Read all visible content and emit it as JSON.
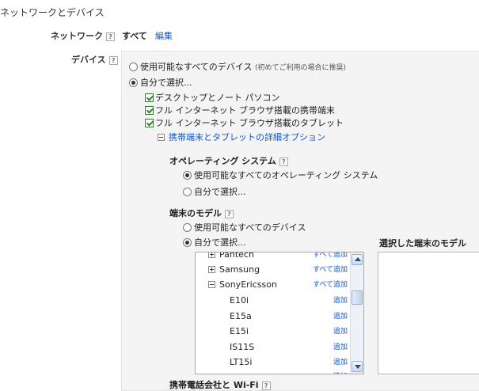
{
  "page": {
    "title": "ネットワークとデバイス"
  },
  "network": {
    "label": "ネットワーク",
    "help": "?",
    "value": "すべて",
    "edit_link": "編集"
  },
  "devices": {
    "label": "デバイス",
    "help": "?",
    "all_devices": {
      "label": "使用可能なすべてのデバイス",
      "hint": "(初めてご利用の場合に推奨)",
      "selected": false
    },
    "custom": {
      "label": "自分で選択...",
      "selected": true
    },
    "checkboxes": [
      {
        "label": "デスクトップとノート パソコン",
        "checked": true
      },
      {
        "label": "フル インターネット ブラウザ搭載の携帯端末",
        "checked": true
      },
      {
        "label": "フル インターネット ブラウザ搭載のタブレット",
        "checked": true
      }
    ],
    "advanced_link": "携帯端末とタブレットの詳細オプション"
  },
  "os": {
    "title": "オペレーティング システム",
    "help": "?",
    "all": {
      "label": "使用可能なすべてのオペレーティング システム",
      "selected": true
    },
    "custom": {
      "label": "自分で選択...",
      "selected": false
    }
  },
  "model": {
    "title": "端末のモデル",
    "help": "?",
    "all": {
      "label": "使用可能なすべてのデバイス",
      "selected": false
    },
    "custom": {
      "label": "自分で選択...",
      "selected": true
    },
    "selected_title": "選択した端末のモデル",
    "list": [
      {
        "name": "Pantech",
        "action": "すべて追加",
        "kind": "group",
        "expanded": false
      },
      {
        "name": "Samsung",
        "action": "すべて追加",
        "kind": "group",
        "expanded": false
      },
      {
        "name": "SonyEricsson",
        "action": "すべて追加",
        "kind": "group",
        "expanded": true
      },
      {
        "name": "E10i",
        "action": "追加",
        "kind": "item"
      },
      {
        "name": "E15a",
        "action": "追加",
        "kind": "item"
      },
      {
        "name": "E15i",
        "action": "追加",
        "kind": "item"
      },
      {
        "name": "IS11S",
        "action": "追加",
        "kind": "item"
      },
      {
        "name": "LT15i",
        "action": "追加",
        "kind": "item"
      },
      {
        "name": "",
        "action": "追加",
        "kind": "item"
      }
    ]
  },
  "carrier": {
    "title": "携帯電話会社と Wi-Fi",
    "help": "?"
  }
}
